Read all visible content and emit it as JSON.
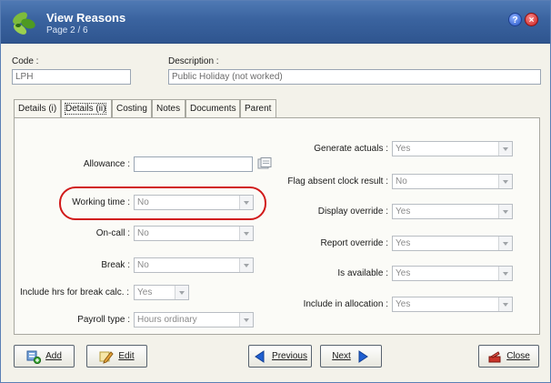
{
  "window": {
    "title": "View Reasons",
    "page_indicator": "Page 2 / 6",
    "help_icon": "?",
    "close_icon": "×"
  },
  "header": {
    "code_label": "Code :",
    "code_value": "LPH",
    "description_label": "Description :",
    "description_value": "Public Holiday (not worked)"
  },
  "tabs": [
    {
      "label": "Details (i)",
      "active": false
    },
    {
      "label": "Details (ii)",
      "active": true
    },
    {
      "label": "Costing",
      "active": false
    },
    {
      "label": "Notes",
      "active": false
    },
    {
      "label": "Documents",
      "active": false
    },
    {
      "label": "Parent",
      "active": false
    }
  ],
  "left_fields": {
    "allowance_label": "Allowance :",
    "allowance_value": "",
    "working_time_label": "Working time :",
    "working_time_value": "No",
    "on_call_label": "On-call :",
    "on_call_value": "No",
    "break_label": "Break :",
    "break_value": "No",
    "include_hrs_label": "Include hrs for break calc. :",
    "include_hrs_value": "Yes",
    "payroll_type_label": "Payroll type :",
    "payroll_type_value": "Hours ordinary"
  },
  "right_fields": {
    "generate_actuals_label": "Generate actuals :",
    "generate_actuals_value": "Yes",
    "flag_absent_label": "Flag absent clock result :",
    "flag_absent_value": "No",
    "display_override_label": "Display override :",
    "display_override_value": "Yes",
    "report_override_label": "Report override :",
    "report_override_value": "Yes",
    "is_available_label": "Is available :",
    "is_available_value": "Yes",
    "include_allocation_label": "Include in allocation :",
    "include_allocation_value": "Yes"
  },
  "buttons": {
    "add": "Add",
    "edit": "Edit",
    "previous": "Previous",
    "next": "Next",
    "close": "Close"
  },
  "colors": {
    "titlebar": "#3a639f",
    "highlight": "#d11a1a",
    "accent_blue": "#1f5fd1"
  }
}
